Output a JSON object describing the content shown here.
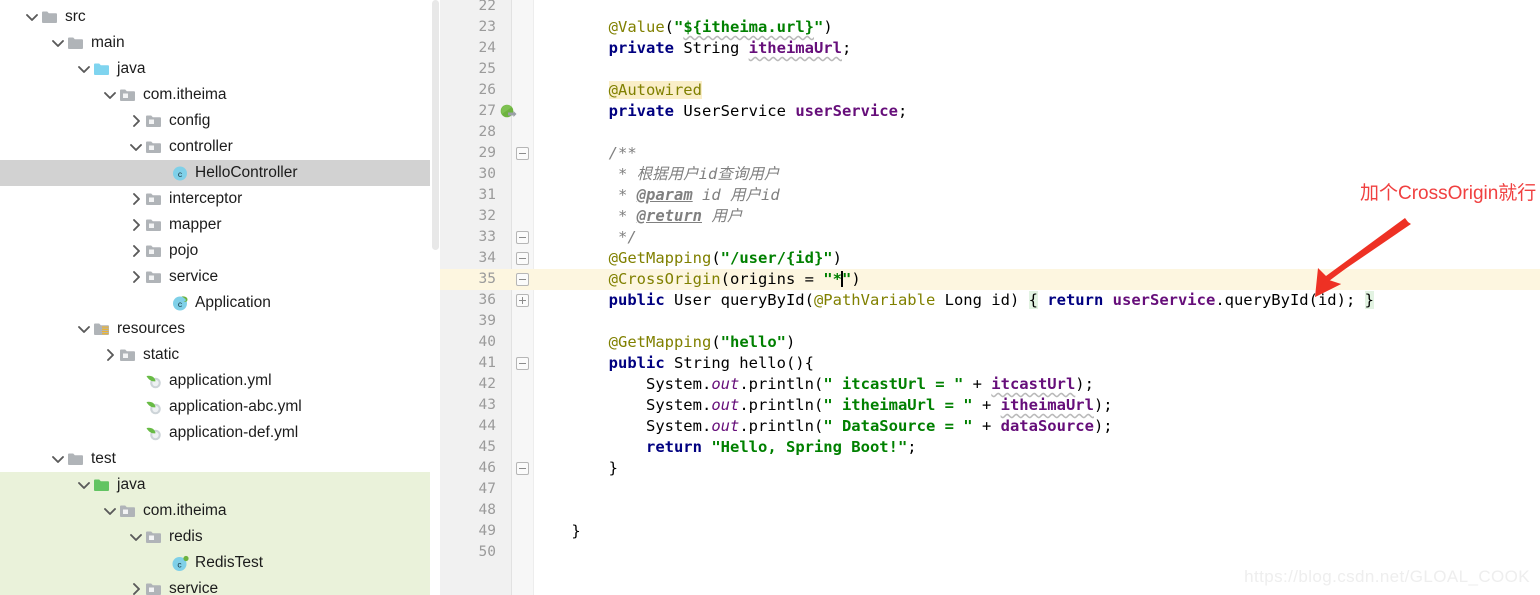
{
  "sidebar": {
    "scroll_thumb": true,
    "rows": [
      {
        "label": "src",
        "indent": 0,
        "arrow": "down",
        "icon": "folder-gray",
        "state": "normal"
      },
      {
        "label": "main",
        "indent": 1,
        "arrow": "down",
        "icon": "folder-gray",
        "state": "normal"
      },
      {
        "label": "java",
        "indent": 2,
        "arrow": "down",
        "icon": "folder-blue",
        "state": "normal"
      },
      {
        "label": "com.itheima",
        "indent": 3,
        "arrow": "down",
        "icon": "folder-package",
        "state": "normal"
      },
      {
        "label": "config",
        "indent": 4,
        "arrow": "right",
        "icon": "folder-package",
        "state": "normal"
      },
      {
        "label": "controller",
        "indent": 4,
        "arrow": "down",
        "icon": "folder-package",
        "state": "normal"
      },
      {
        "label": "HelloController",
        "indent": 5,
        "arrow": "none",
        "icon": "class-java",
        "state": "selected"
      },
      {
        "label": "interceptor",
        "indent": 4,
        "arrow": "right",
        "icon": "folder-package",
        "state": "normal"
      },
      {
        "label": "mapper",
        "indent": 4,
        "arrow": "right",
        "icon": "folder-package",
        "state": "normal"
      },
      {
        "label": "pojo",
        "indent": 4,
        "arrow": "right",
        "icon": "folder-package",
        "state": "normal"
      },
      {
        "label": "service",
        "indent": 4,
        "arrow": "right",
        "icon": "folder-package",
        "state": "normal"
      },
      {
        "label": "Application",
        "indent": 5,
        "arrow": "none",
        "icon": "class-spring",
        "state": "normal"
      },
      {
        "label": "resources",
        "indent": 2,
        "arrow": "down",
        "icon": "folder-res",
        "state": "normal"
      },
      {
        "label": "static",
        "indent": 3,
        "arrow": "right",
        "icon": "folder-package",
        "state": "normal"
      },
      {
        "label": "application.yml",
        "indent": 4,
        "arrow": "none",
        "icon": "file-yaml",
        "state": "normal"
      },
      {
        "label": "application-abc.yml",
        "indent": 4,
        "arrow": "none",
        "icon": "file-yaml",
        "state": "normal"
      },
      {
        "label": "application-def.yml",
        "indent": 4,
        "arrow": "none",
        "icon": "file-yaml",
        "state": "normal"
      },
      {
        "label": "test",
        "indent": 1,
        "arrow": "down",
        "icon": "folder-gray",
        "state": "normal"
      },
      {
        "label": "java",
        "indent": 2,
        "arrow": "down",
        "icon": "folder-green",
        "state": "green"
      },
      {
        "label": "com.itheima",
        "indent": 3,
        "arrow": "down",
        "icon": "folder-package",
        "state": "green"
      },
      {
        "label": "redis",
        "indent": 4,
        "arrow": "down",
        "icon": "folder-package",
        "state": "green"
      },
      {
        "label": "RedisTest",
        "indent": 5,
        "arrow": "none",
        "icon": "class-test",
        "state": "green"
      },
      {
        "label": "service",
        "indent": 4,
        "arrow": "right",
        "icon": "folder-package",
        "state": "green"
      }
    ]
  },
  "editor": {
    "first_line_number": 22,
    "highlighted_line": 35,
    "lines": [
      {
        "n": 22,
        "segs": []
      },
      {
        "n": 23,
        "segs": [
          {
            "t": "        ",
            "c": "plain"
          },
          {
            "t": "@Value",
            "c": "ann"
          },
          {
            "t": "(",
            "c": "plain"
          },
          {
            "t": "\"",
            "c": "str"
          },
          {
            "t": "${itheima.url}",
            "c": "str squig"
          },
          {
            "t": "\"",
            "c": "str"
          },
          {
            "t": ")",
            "c": "plain"
          }
        ]
      },
      {
        "n": 24,
        "segs": [
          {
            "t": "        ",
            "c": "plain"
          },
          {
            "t": "private",
            "c": "kw"
          },
          {
            "t": " String ",
            "c": "plain"
          },
          {
            "t": "itheimaUrl",
            "c": "fld squig"
          },
          {
            "t": ";",
            "c": "plain"
          }
        ]
      },
      {
        "n": 25,
        "segs": []
      },
      {
        "n": 26,
        "segs": [
          {
            "t": "        ",
            "c": "plain"
          },
          {
            "t": "@Autowired",
            "c": "ann ann-hl"
          }
        ],
        "gutter_icon": "none"
      },
      {
        "n": 27,
        "segs": [
          {
            "t": "        ",
            "c": "plain"
          },
          {
            "t": "private",
            "c": "kw"
          },
          {
            "t": " UserService ",
            "c": "plain"
          },
          {
            "t": "userService",
            "c": "fld"
          },
          {
            "t": ";",
            "c": "plain"
          }
        ],
        "gutter_icon": "spring-bean"
      },
      {
        "n": 28,
        "segs": []
      },
      {
        "n": 29,
        "segs": [
          {
            "t": "        ",
            "c": "plain"
          },
          {
            "t": "/**",
            "c": "cmt"
          }
        ],
        "fold": "minus"
      },
      {
        "n": 30,
        "segs": [
          {
            "t": "         ",
            "c": "plain"
          },
          {
            "t": "* 根据用户id查询用户",
            "c": "cmt"
          }
        ]
      },
      {
        "n": 31,
        "segs": [
          {
            "t": "         ",
            "c": "plain"
          },
          {
            "t": "* ",
            "c": "cmt"
          },
          {
            "t": "@param",
            "c": "tag"
          },
          {
            "t": " id",
            "c": "cmt"
          },
          {
            "t": " 用户id",
            "c": "cmt"
          }
        ]
      },
      {
        "n": 32,
        "segs": [
          {
            "t": "         ",
            "c": "plain"
          },
          {
            "t": "* ",
            "c": "cmt"
          },
          {
            "t": "@return",
            "c": "tag"
          },
          {
            "t": " 用户",
            "c": "cmt"
          }
        ]
      },
      {
        "n": 33,
        "segs": [
          {
            "t": "         ",
            "c": "plain"
          },
          {
            "t": "*/",
            "c": "cmt"
          }
        ],
        "fold": "minus"
      },
      {
        "n": 34,
        "segs": [
          {
            "t": "        ",
            "c": "plain"
          },
          {
            "t": "@GetMapping",
            "c": "ann"
          },
          {
            "t": "(",
            "c": "plain"
          },
          {
            "t": "\"/user/{id}\"",
            "c": "str"
          },
          {
            "t": ")",
            "c": "plain"
          }
        ],
        "fold": "minus"
      },
      {
        "n": 35,
        "segs": [
          {
            "t": "        ",
            "c": "plain"
          },
          {
            "t": "@CrossOrigin",
            "c": "ann"
          },
          {
            "t": "(origins = ",
            "c": "plain"
          },
          {
            "t": "\"",
            "c": "str"
          },
          {
            "t": "*",
            "c": "str"
          },
          {
            "t": "CARET",
            "c": "caret"
          },
          {
            "t": "\"",
            "c": "str"
          },
          {
            "t": ")",
            "c": "plain"
          }
        ],
        "fold": "minus"
      },
      {
        "n": 36,
        "segs": [
          {
            "t": "        ",
            "c": "plain"
          },
          {
            "t": "public",
            "c": "kw"
          },
          {
            "t": " User queryById(",
            "c": "plain"
          },
          {
            "t": "@PathVariable",
            "c": "ann"
          },
          {
            "t": " Long id) ",
            "c": "plain"
          },
          {
            "t": "{",
            "c": "plain brace-hl"
          },
          {
            "t": " ",
            "c": "plain"
          },
          {
            "t": "return",
            "c": "kw"
          },
          {
            "t": " ",
            "c": "plain"
          },
          {
            "t": "userService",
            "c": "fld"
          },
          {
            "t": ".queryById(id); ",
            "c": "plain"
          },
          {
            "t": "}",
            "c": "plain brace-hl"
          }
        ],
        "fold": "plus"
      },
      {
        "n": 39,
        "segs": []
      },
      {
        "n": 40,
        "segs": [
          {
            "t": "        ",
            "c": "plain"
          },
          {
            "t": "@GetMapping",
            "c": "ann"
          },
          {
            "t": "(",
            "c": "plain"
          },
          {
            "t": "\"hello\"",
            "c": "str"
          },
          {
            "t": ")",
            "c": "plain"
          }
        ]
      },
      {
        "n": 41,
        "segs": [
          {
            "t": "        ",
            "c": "plain"
          },
          {
            "t": "public",
            "c": "kw"
          },
          {
            "t": " String hello(){",
            "c": "plain"
          }
        ],
        "fold": "minus"
      },
      {
        "n": 42,
        "segs": [
          {
            "t": "            ",
            "c": "plain"
          },
          {
            "t": "System.",
            "c": "plain"
          },
          {
            "t": "out",
            "c": "stat"
          },
          {
            "t": ".println(",
            "c": "plain"
          },
          {
            "t": "\" itcastUrl = \"",
            "c": "str"
          },
          {
            "t": " + ",
            "c": "plain"
          },
          {
            "t": "itcastUrl",
            "c": "fld squig"
          },
          {
            "t": ");",
            "c": "plain"
          }
        ]
      },
      {
        "n": 43,
        "segs": [
          {
            "t": "            ",
            "c": "plain"
          },
          {
            "t": "System.",
            "c": "plain"
          },
          {
            "t": "out",
            "c": "stat"
          },
          {
            "t": ".println(",
            "c": "plain"
          },
          {
            "t": "\" itheimaUrl = \"",
            "c": "str"
          },
          {
            "t": " + ",
            "c": "plain"
          },
          {
            "t": "itheimaUrl",
            "c": "fld squig"
          },
          {
            "t": ");",
            "c": "plain"
          }
        ]
      },
      {
        "n": 44,
        "segs": [
          {
            "t": "            ",
            "c": "plain"
          },
          {
            "t": "System.",
            "c": "plain"
          },
          {
            "t": "out",
            "c": "stat"
          },
          {
            "t": ".println(",
            "c": "plain"
          },
          {
            "t": "\" DataSource = \"",
            "c": "str"
          },
          {
            "t": " + ",
            "c": "plain"
          },
          {
            "t": "dataSource",
            "c": "fld"
          },
          {
            "t": ");",
            "c": "plain"
          }
        ]
      },
      {
        "n": 45,
        "segs": [
          {
            "t": "            ",
            "c": "plain"
          },
          {
            "t": "return",
            "c": "kw"
          },
          {
            "t": " ",
            "c": "plain"
          },
          {
            "t": "\"Hello, Spring Boot!\"",
            "c": "str"
          },
          {
            "t": ";",
            "c": "plain"
          }
        ]
      },
      {
        "n": 46,
        "segs": [
          {
            "t": "        ",
            "c": "plain"
          },
          {
            "t": "}",
            "c": "plain"
          }
        ],
        "fold": "minus"
      },
      {
        "n": 47,
        "segs": []
      },
      {
        "n": 48,
        "segs": []
      },
      {
        "n": 49,
        "segs": [
          {
            "t": "    ",
            "c": "plain"
          },
          {
            "t": "}",
            "c": "plain"
          }
        ]
      },
      {
        "n": 50,
        "segs": []
      }
    ]
  },
  "annotation": {
    "text": "加个CrossOrigin就行",
    "color": "#f04040",
    "arrow": "arrow-down-left"
  },
  "watermark": {
    "text": "https://blog.csdn.net/GLOAL_COOK"
  }
}
